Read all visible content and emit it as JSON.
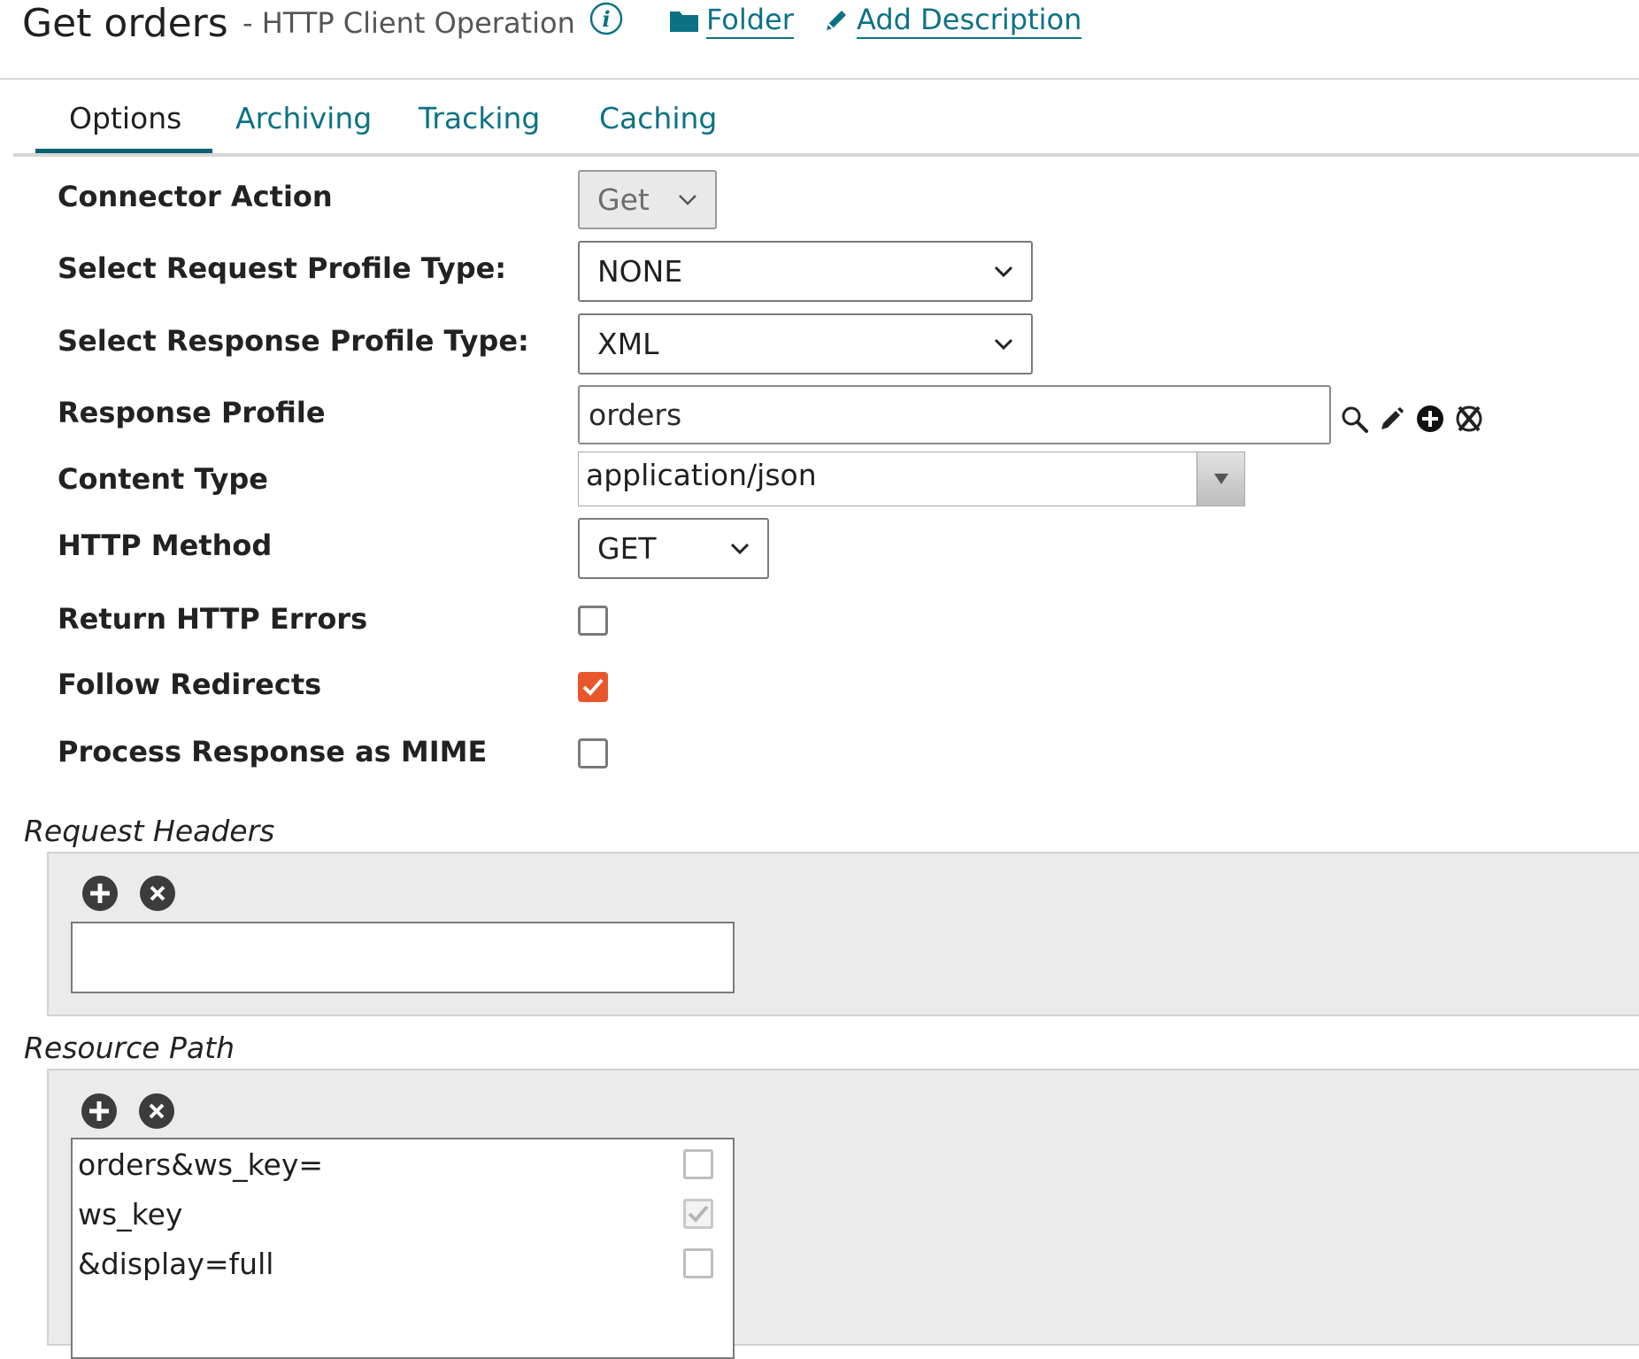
{
  "header": {
    "title": "Get orders",
    "subtitle": "- HTTP Client Operation",
    "folder_link": "Folder",
    "add_description_link": "Add Description"
  },
  "tabs": [
    {
      "label": "Options",
      "active": true
    },
    {
      "label": "Archiving",
      "active": false
    },
    {
      "label": "Tracking",
      "active": false
    },
    {
      "label": "Caching",
      "active": false
    }
  ],
  "form": {
    "connector_action": {
      "label": "Connector Action",
      "value": "Get",
      "disabled": true
    },
    "request_profile_type": {
      "label": "Select Request Profile Type:",
      "value": "NONE"
    },
    "response_profile_type": {
      "label": "Select Response Profile Type:",
      "value": "XML"
    },
    "response_profile": {
      "label": "Response Profile",
      "value": "orders"
    },
    "content_type": {
      "label": "Content Type",
      "value": "application/json"
    },
    "http_method": {
      "label": "HTTP Method",
      "value": "GET"
    },
    "return_http_errors": {
      "label": "Return HTTP Errors",
      "checked": false
    },
    "follow_redirects": {
      "label": "Follow Redirects",
      "checked": true
    },
    "process_response_mime": {
      "label": "Process Response as MIME",
      "checked": false
    }
  },
  "request_headers": {
    "title": "Request Headers",
    "rows": []
  },
  "resource_path": {
    "title": "Resource Path",
    "rows": [
      {
        "text": "orders&ws_key=",
        "replacement_variable": false
      },
      {
        "text": "ws_key",
        "replacement_variable": true
      },
      {
        "text": "&display=full",
        "replacement_variable": false
      }
    ]
  },
  "colors": {
    "link": "#0b7285",
    "tab_underline": "#0a5f73",
    "checkbox_checked": "#e8562a",
    "panel_bg": "#ebebeb"
  }
}
